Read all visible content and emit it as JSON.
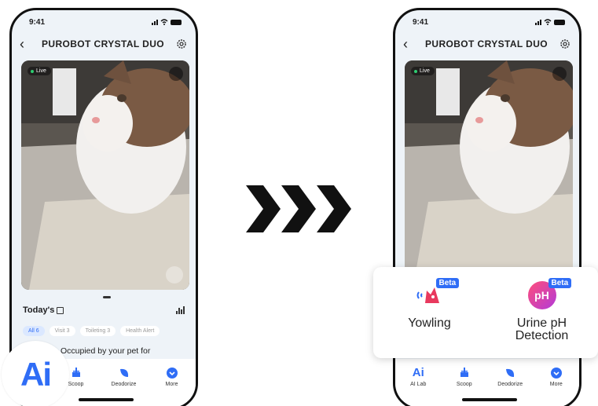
{
  "left_phone": {
    "status": {
      "time": "9:41"
    },
    "nav": {
      "title": "PUROBOT CRYSTAL DUO"
    },
    "camera": {
      "live_label": "Live"
    },
    "today": {
      "title": "Today's"
    },
    "filters": [
      {
        "label": "All 6",
        "active": true
      },
      {
        "label": "Visit 3",
        "active": false
      },
      {
        "label": "Toileting 3",
        "active": false
      },
      {
        "label": "Health Alert",
        "active": false
      }
    ],
    "event_text": "Occupied by your pet for",
    "tabs": [
      {
        "label": "Scoop",
        "icon": "scoop-icon"
      },
      {
        "label": "Deodorize",
        "icon": "leaf-icon"
      },
      {
        "label": "More",
        "icon": "chevron-down-circle-icon"
      }
    ],
    "ai_badge": "Ai"
  },
  "right_phone": {
    "status": {
      "time": "9:41"
    },
    "nav": {
      "title": "PUROBOT CRYSTAL DUO"
    },
    "camera": {
      "live_label": "Live"
    },
    "tabs": [
      {
        "label": "AI Lab",
        "icon_text": "Ai"
      },
      {
        "label": "Scoop",
        "icon": "scoop-icon"
      },
      {
        "label": "Deodorize",
        "icon": "leaf-icon"
      },
      {
        "label": "More",
        "icon": "chevron-down-circle-icon"
      }
    ]
  },
  "features": [
    {
      "label": "Yowling",
      "badge": "Beta",
      "icon": "cat-sound-icon"
    },
    {
      "label": "Urine pH Detection",
      "label_line1": "Urine pH",
      "label_line2": "Detection",
      "badge": "Beta",
      "icon_text": "pH"
    }
  ],
  "colors": {
    "accent": "#2f6df6",
    "ph_gradient_start": "#ff4d7a",
    "ph_gradient_end": "#b23bd9"
  }
}
